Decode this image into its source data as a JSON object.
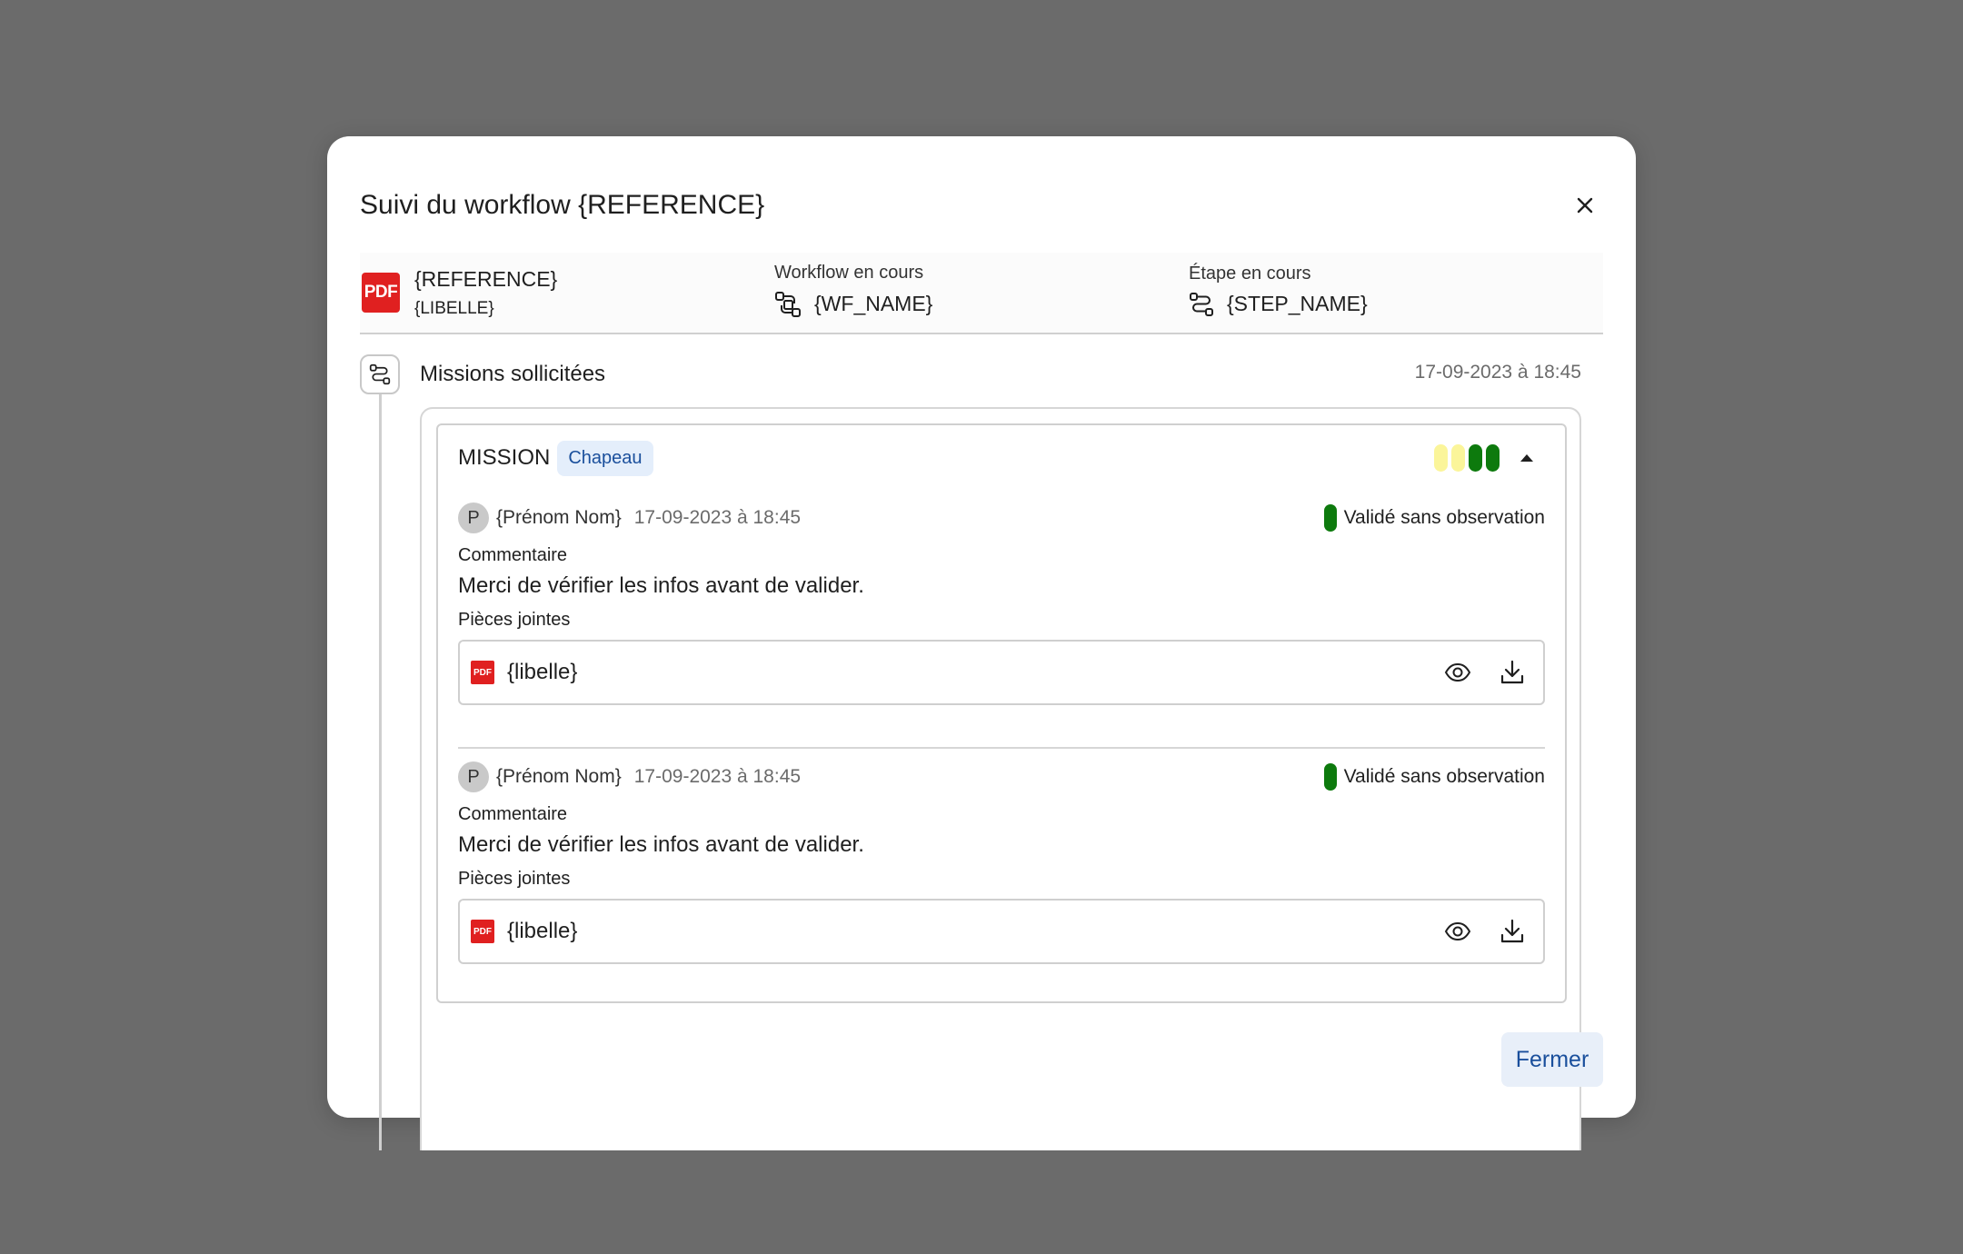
{
  "modal": {
    "title": "Suivi du workflow {REFERENCE}",
    "close_icon": "close-icon"
  },
  "document": {
    "icon_label": "PDF",
    "reference": "{REFERENCE}",
    "libelle": "{LIBELLE}"
  },
  "workflow": {
    "label": "Workflow en cours",
    "value": "{WF_NAME}",
    "icon": "workflow-icon"
  },
  "step": {
    "label": "Étape en cours",
    "value": "{STEP_NAME}",
    "icon": "route-icon"
  },
  "timeline": {
    "title": "Missions sollicitées",
    "date": "17-09-2023 à 18:45"
  },
  "mission": {
    "label": "MISSION",
    "tag": "Chapeau",
    "progress_colors": [
      "#fbf59a",
      "#fbf59a",
      "#0d7a0d",
      "#0d7a0d"
    ],
    "entries": [
      {
        "avatar": "P",
        "author": "{Prénom Nom}",
        "date": "17-09-2023 à 18:45",
        "status": "Validé sans observation",
        "status_color": "#0d7a0d",
        "comment_label": "Commentaire",
        "comment": "Merci de vérifier les infos avant de valider.",
        "attachments_label": "Pièces jointes",
        "attachment_icon_label": "PDF",
        "attachment_name": "{libelle}"
      },
      {
        "avatar": "P",
        "author": "{Prénom Nom}",
        "date": "17-09-2023 à 18:45",
        "status": "Validé sans observation",
        "status_color": "#0d7a0d",
        "comment_label": "Commentaire",
        "comment": "Merci de vérifier les infos avant de valider.",
        "attachments_label": "Pièces jointes",
        "attachment_icon_label": "PDF",
        "attachment_name": "{libelle}"
      }
    ]
  },
  "footer": {
    "close_label": "Fermer"
  }
}
